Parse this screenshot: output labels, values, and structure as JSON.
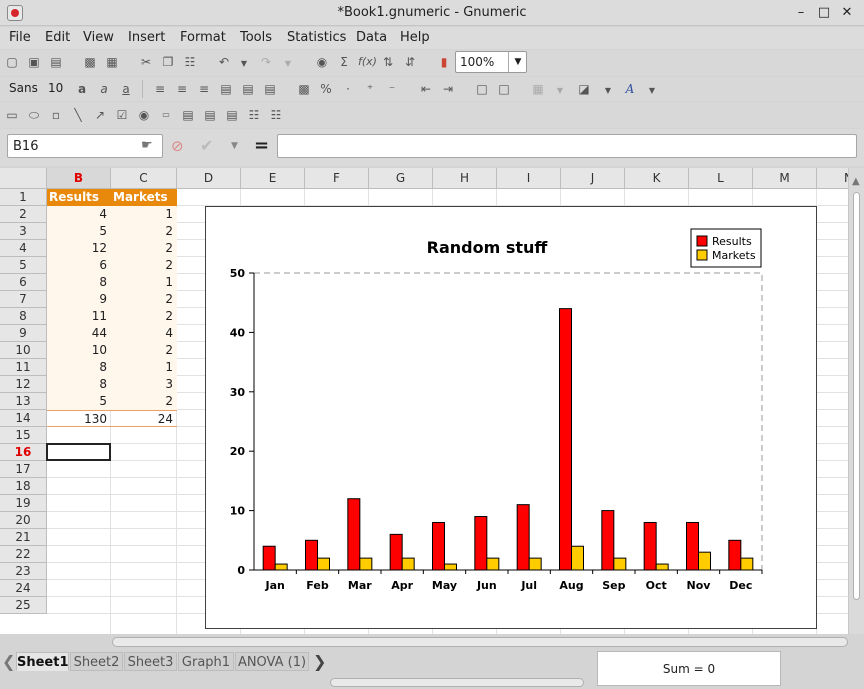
{
  "window": {
    "title": "*Book1.gnumeric - Gnumeric",
    "minimize": "–",
    "maximize": "□",
    "close": "✕"
  },
  "menu": [
    "File",
    "Edit",
    "View",
    "Insert",
    "Format",
    "Tools",
    "Statistics",
    "Data",
    "Help"
  ],
  "toolbar": {
    "zoom": "100%",
    "font_name": "Sans",
    "font_size": "10"
  },
  "formula_bar": {
    "cell_ref": "B16",
    "equals": "=",
    "formula": ""
  },
  "columns": [
    "B",
    "C",
    "D",
    "E",
    "F",
    "G",
    "H",
    "I",
    "J",
    "K",
    "L",
    "M",
    "N"
  ],
  "selected_column": "B",
  "selected_row": 16,
  "rows": [
    1,
    2,
    3,
    4,
    5,
    6,
    7,
    8,
    9,
    10,
    11,
    12,
    13,
    14,
    15,
    16,
    17,
    18,
    19,
    20,
    21,
    22,
    23,
    24,
    25
  ],
  "table": {
    "headers": [
      "Results",
      "Markets"
    ],
    "results": [
      4,
      5,
      12,
      6,
      8,
      9,
      11,
      44,
      10,
      8,
      8,
      5
    ],
    "markets": [
      1,
      2,
      2,
      2,
      1,
      2,
      2,
      4,
      2,
      1,
      3,
      2
    ],
    "totals": [
      130,
      24
    ]
  },
  "colors": {
    "header_fill": "#e8890c",
    "data_fill": "#fff6ec",
    "results": "#ff0000",
    "markets": "#ffcc00",
    "selection": "#e00000"
  },
  "chart_data": {
    "type": "bar",
    "title": "Random stuff",
    "categories": [
      "Jan",
      "Feb",
      "Mar",
      "Apr",
      "May",
      "Jun",
      "Jul",
      "Aug",
      "Sep",
      "Oct",
      "Nov",
      "Dec"
    ],
    "series": [
      {
        "name": "Results",
        "values": [
          4,
          5,
          12,
          6,
          8,
          9,
          11,
          44,
          10,
          8,
          8,
          5
        ],
        "color": "#ff0000"
      },
      {
        "name": "Markets",
        "values": [
          1,
          2,
          2,
          2,
          1,
          2,
          2,
          4,
          2,
          1,
          3,
          2
        ],
        "color": "#ffcc00"
      }
    ],
    "ylim": [
      0,
      50
    ],
    "yticks": [
      0,
      10,
      20,
      30,
      40,
      50
    ],
    "legend": "top-right",
    "grid": false
  },
  "sheets": [
    "Sheet1",
    "Sheet2",
    "Sheet3",
    "Graph1",
    "ANOVA (1)"
  ],
  "active_sheet": "Sheet1",
  "status": {
    "sum": "Sum = 0"
  }
}
